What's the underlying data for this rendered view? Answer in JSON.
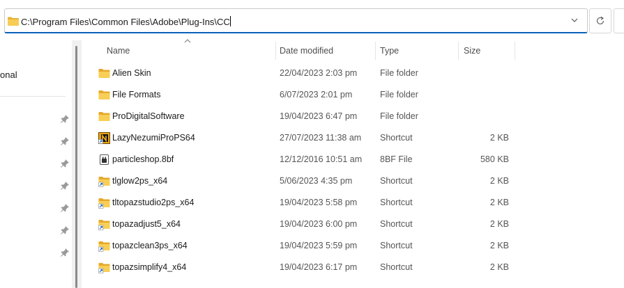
{
  "address": {
    "path": "C:\\Program Files\\Common Files\\Adobe\\Plug-Ins\\CC"
  },
  "nav": {
    "quick_access_label": "onal"
  },
  "columns": {
    "name": "Name",
    "date": "Date modified",
    "type": "Type",
    "size": "Size"
  },
  "files": [
    {
      "name": "Alien Skin",
      "date": "22/04/2023 2:03 pm",
      "type": "File folder",
      "size": "",
      "icon": "folder-icon"
    },
    {
      "name": "File Formats",
      "date": "6/07/2023 2:01 pm",
      "type": "File folder",
      "size": "",
      "icon": "folder-icon"
    },
    {
      "name": "ProDigitalSoftware",
      "date": "19/04/2023 6:47 pm",
      "type": "File folder",
      "size": "",
      "icon": "folder-icon"
    },
    {
      "name": "LazyNezumiProPS64",
      "date": "27/07/2023 11:38 am",
      "type": "Shortcut",
      "size": "2 KB",
      "icon": "lazynezumi-shortcut-icon"
    },
    {
      "name": "particleshop.8bf",
      "date": "12/12/2016 10:51 am",
      "type": "8BF File",
      "size": "580 KB",
      "icon": "plugin-file-icon"
    },
    {
      "name": "tlglow2ps_x64",
      "date": "5/06/2023 4:35 pm",
      "type": "Shortcut",
      "size": "2 KB",
      "icon": "folder-shortcut-icon"
    },
    {
      "name": "tltopazstudio2ps_x64",
      "date": "19/04/2023 5:58 pm",
      "type": "Shortcut",
      "size": "2 KB",
      "icon": "folder-shortcut-icon"
    },
    {
      "name": "topazadjust5_x64",
      "date": "19/04/2023 6:00 pm",
      "type": "Shortcut",
      "size": "2 KB",
      "icon": "folder-shortcut-icon"
    },
    {
      "name": "topazclean3ps_x64",
      "date": "19/04/2023 5:59 pm",
      "type": "Shortcut",
      "size": "2 KB",
      "icon": "folder-shortcut-icon"
    },
    {
      "name": "topazsimplify4_x64",
      "date": "19/04/2023 6:17 pm",
      "type": "Shortcut",
      "size": "2 KB",
      "icon": "folder-shortcut-icon"
    }
  ]
}
